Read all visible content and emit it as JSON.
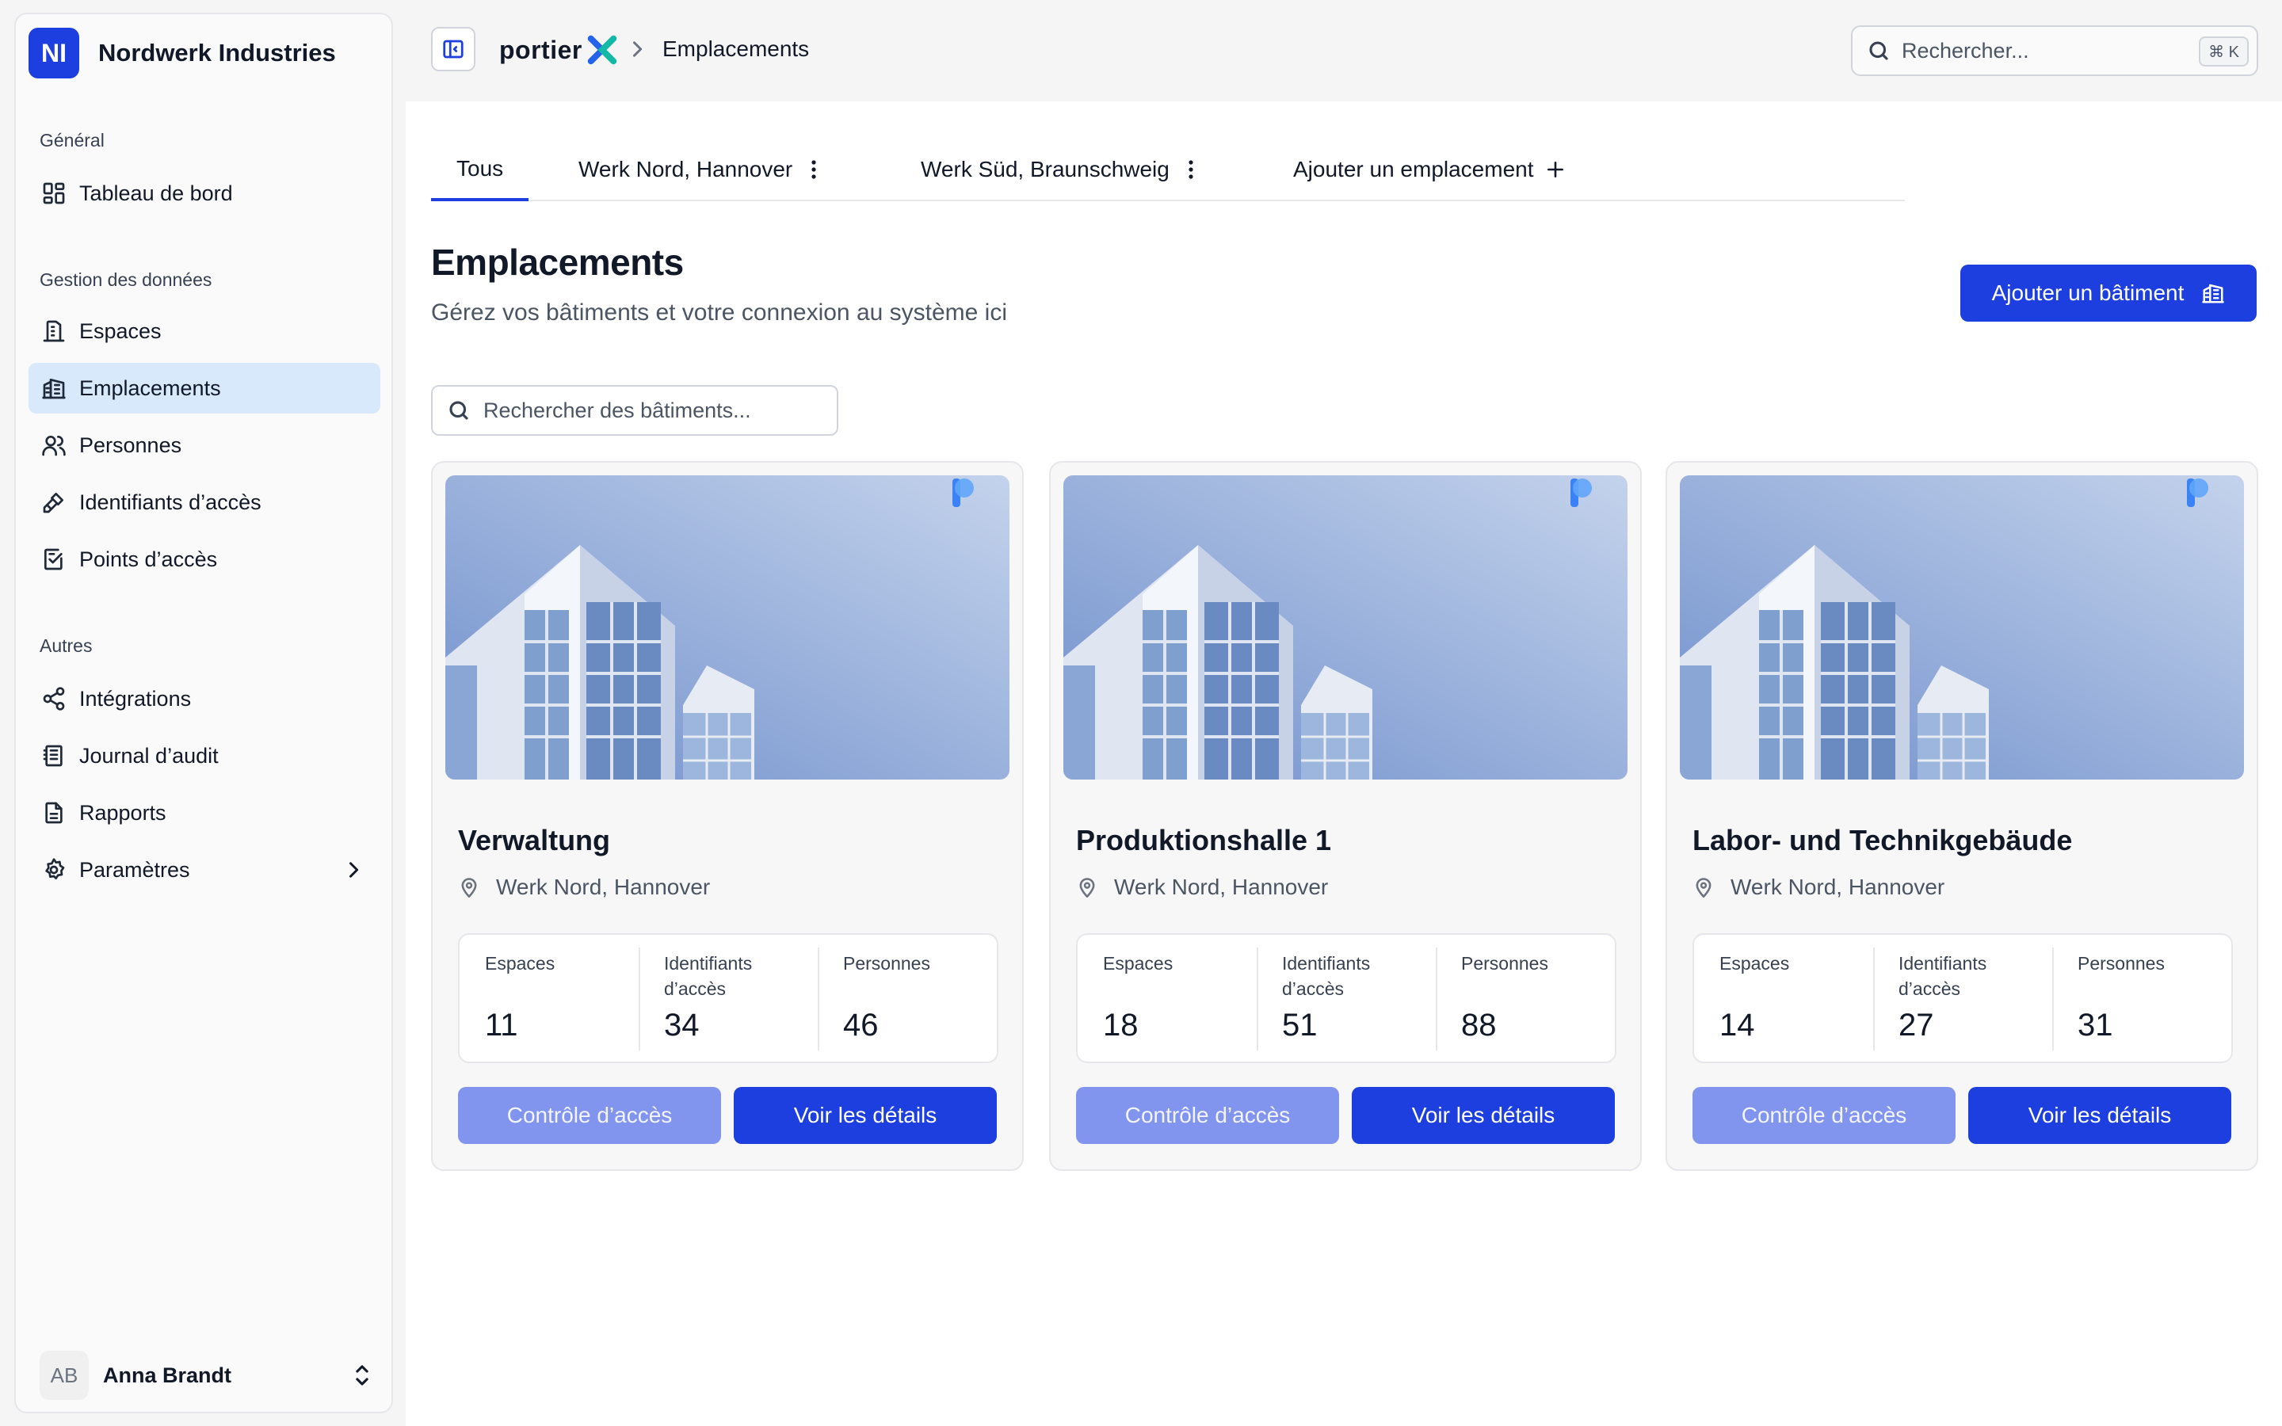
{
  "sidebar": {
    "org": {
      "initials": "NI",
      "name": "Nordwerk Industries"
    },
    "sections": [
      {
        "label": "Général",
        "items": [
          {
            "label": "Tableau de bord",
            "icon": "dashboard-icon"
          }
        ]
      },
      {
        "label": "Gestion des données",
        "items": [
          {
            "label": "Espaces",
            "icon": "building-icon"
          },
          {
            "label": "Emplacements",
            "icon": "office-building-icon",
            "active": true
          },
          {
            "label": "Personnes",
            "icon": "users-icon"
          },
          {
            "label": "Identifiants d’accès",
            "icon": "key-icon"
          },
          {
            "label": "Points d’accès",
            "icon": "access-point-icon"
          }
        ]
      },
      {
        "label": "Autres",
        "items": [
          {
            "label": "Intégrations",
            "icon": "share-icon"
          },
          {
            "label": "Journal d’audit",
            "icon": "log-icon"
          },
          {
            "label": "Rapports",
            "icon": "report-icon"
          },
          {
            "label": "Paramètres",
            "icon": "gear-icon"
          }
        ]
      }
    ],
    "user": {
      "initials": "AB",
      "name": "Anna Brandt"
    }
  },
  "topbar": {
    "brand": "portier",
    "breadcrumb": "Emplacements",
    "search": {
      "placeholder": "Rechercher...",
      "shortcut": "⌘ K"
    }
  },
  "tabs": [
    {
      "label": "Tous",
      "active": true
    },
    {
      "label": "Werk Nord, Hannover"
    },
    {
      "label": "Werk Süd, Braunschweig"
    },
    {
      "label": "Ajouter un emplacement"
    }
  ],
  "page": {
    "title": "Emplacements",
    "subtitle": "Gérez vos bâtiments et votre connexion au système ici",
    "add_button": "Ajouter un bâtiment",
    "search_placeholder": "Rechercher des bâtiments..."
  },
  "stat_labels": {
    "spaces": "Espaces",
    "credentials": "Identifiants d’accès",
    "people": "Personnes"
  },
  "buttons": {
    "access": "Contrôle d’accès",
    "details": "Voir les détails"
  },
  "buildings": [
    {
      "name": "Verwaltung",
      "location": "Werk Nord, Hannover",
      "spaces": "11",
      "credentials": "34",
      "people": "46"
    },
    {
      "name": "Produktionshalle 1",
      "location": "Werk Nord, Hannover",
      "spaces": "18",
      "credentials": "51",
      "people": "88"
    },
    {
      "name": "Labor- und Technikgebäude",
      "location": "Werk Nord, Hannover",
      "spaces": "14",
      "credentials": "27",
      "people": "31"
    }
  ],
  "colors": {
    "accent": "#1d3fe0",
    "accent_light": "#8194ee",
    "active_nav": "#d7e9fb"
  }
}
